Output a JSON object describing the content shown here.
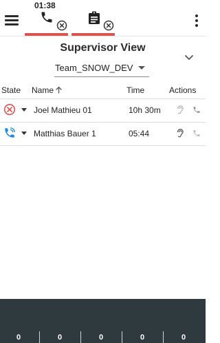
{
  "topbar": {
    "menu_icon": "hamburger-icon",
    "more_icon": "more-vertical-icon",
    "tabs": [
      {
        "name": "call",
        "timer": "01:38",
        "icon": "phone-icon",
        "badge_icon": "close-circle-icon"
      },
      {
        "name": "task",
        "icon": "clipboard-icon",
        "badge_icon": "close-circle-icon"
      }
    ],
    "accent_color": "#d9534f"
  },
  "supervisor": {
    "title": "Supervisor View",
    "team_selected": "Team_SNOW_DEV"
  },
  "table": {
    "headers": {
      "state": "State",
      "name": "Name",
      "time": "Time",
      "actions": "Actions"
    },
    "rows": [
      {
        "state_icon": "declined-circle-icon",
        "name": "Joel Mathieu 01",
        "time": "10h 30m"
      },
      {
        "state_icon": "active-call-icon",
        "name": "Matthias Bauer 1",
        "time": "05:44"
      }
    ]
  },
  "footer": {
    "stats": [
      "0",
      "0",
      "0",
      "0",
      "0"
    ],
    "background": "#2e3a3e"
  }
}
